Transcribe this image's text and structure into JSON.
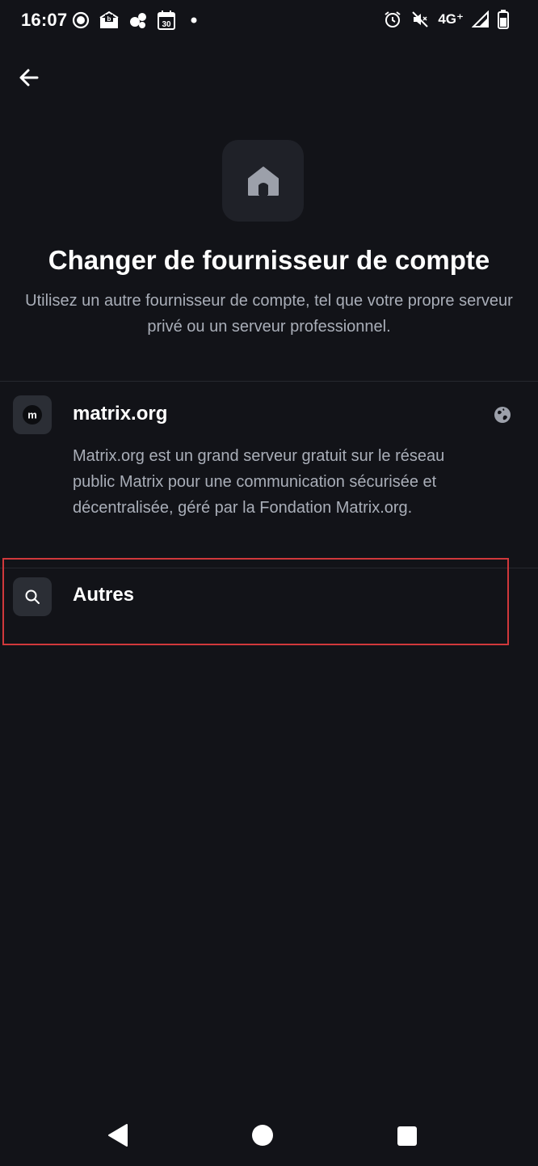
{
  "status_bar": {
    "time": "16:07",
    "network": "4G⁺",
    "left_icons": [
      "signal-app-icon",
      "mail-icon",
      "cluster-icon",
      "calendar-icon",
      "dot-icon"
    ],
    "right_icons": [
      "alarm-icon",
      "mute-icon",
      "cell-signal-icon",
      "battery-icon"
    ],
    "calendar_day": "30"
  },
  "header": {
    "back_icon": "arrow-left-icon",
    "hero_icon": "home-icon",
    "title": "Changer de fournisseur de compte",
    "subtitle": "Utilisez un autre fournisseur de compte, tel que votre propre serveur privé ou un serveur professionnel."
  },
  "providers": [
    {
      "name": "matrix.org",
      "icon_letter": "m",
      "description": "Matrix.org est un grand serveur gratuit sur le réseau public Matrix pour une communication sécurisée et décentralisée, géré par la Fondation Matrix.org.",
      "trailing_icon": "globe-icon"
    },
    {
      "name": "Autres",
      "icon": "search-icon"
    }
  ],
  "colors": {
    "background": "#121318",
    "tile": "#1f2128",
    "secondary_text": "#a9aeb8",
    "highlight": "#d0383b"
  }
}
